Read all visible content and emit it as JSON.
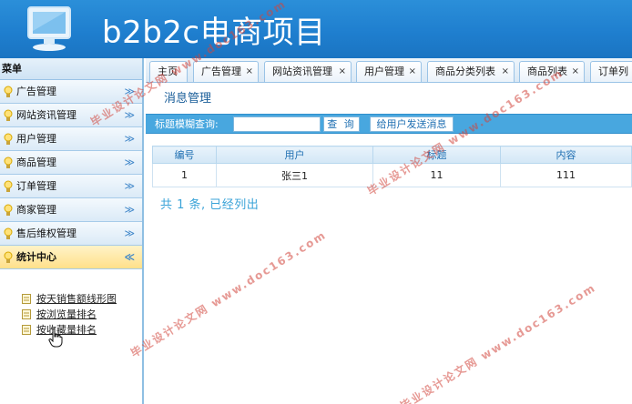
{
  "header": {
    "app_title": "b2b2c电商项目",
    "logo_icon": "monitor-icon",
    "accent_color": "#1f7fcf"
  },
  "sidebar": {
    "title": "菜单",
    "items": [
      {
        "label": "广告管理",
        "icon": "bulb-icon",
        "expanded": false
      },
      {
        "label": "网站资讯管理",
        "icon": "bulb-icon",
        "expanded": false
      },
      {
        "label": "用户管理",
        "icon": "bulb-icon",
        "expanded": false
      },
      {
        "label": "商品管理",
        "icon": "bulb-icon",
        "expanded": false
      },
      {
        "label": "订单管理",
        "icon": "bulb-icon",
        "expanded": false
      },
      {
        "label": "商家管理",
        "icon": "bulb-icon",
        "expanded": false
      },
      {
        "label": "售后维权管理",
        "icon": "bulb-icon",
        "expanded": false
      },
      {
        "label": "统计中心",
        "icon": "bulb-icon",
        "expanded": true
      }
    ],
    "subitems": [
      {
        "label": "按天销售额线形图",
        "icon": "document-icon"
      },
      {
        "label": "按浏览量排名",
        "icon": "document-icon"
      },
      {
        "label": "按收藏量排名",
        "icon": "document-icon"
      }
    ],
    "chevron_down": "≫",
    "chevron_up": "≪"
  },
  "tabs": [
    {
      "label": "主页",
      "closable": false
    },
    {
      "label": "广告管理",
      "closable": true
    },
    {
      "label": "网站资讯管理",
      "closable": true
    },
    {
      "label": "用户管理",
      "closable": true
    },
    {
      "label": "商品分类列表",
      "closable": true
    },
    {
      "label": "商品列表",
      "closable": true
    },
    {
      "label": "订单列",
      "closable": false
    }
  ],
  "tab_close_glyph": "×",
  "panel": {
    "title": "消息管理",
    "search_label": "标题模糊查询:",
    "search_value": "",
    "query_button": "查 询",
    "send_button": "给用户发送消息"
  },
  "table": {
    "columns": [
      "编号",
      "用户",
      "标题",
      "内容"
    ],
    "rows": [
      [
        "1",
        "张三1",
        "11",
        "111"
      ]
    ]
  },
  "summary": "共 1 条, 已经列出",
  "watermark": {
    "cn": "毕业设计论文网",
    "url": "www.doc163.com"
  }
}
